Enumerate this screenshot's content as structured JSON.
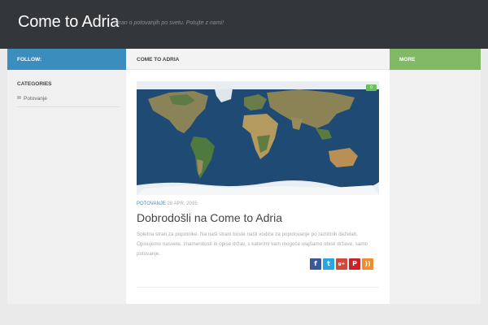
{
  "header": {
    "site_title": "Come to Adria",
    "site_description": "Stran o potovanjih po svetu. Potujte z nami!"
  },
  "sidebar_left": {
    "follow_label": "FOLLOW:",
    "categories_title": "CATEGORIES",
    "categories": [
      {
        "label": "Potovanje"
      }
    ]
  },
  "main": {
    "heading": "COME TO ADRIA",
    "post": {
      "image_icon": "world-map-image",
      "comment_count": "0",
      "comment_icon": "comment-icon",
      "category": "POTOVANJE",
      "date": "28 APR, 2015",
      "title": "Dobrodošli na Come to Adria",
      "excerpt": "Spletna stran za popotnike. Na naši strani boste našli vodiče za popotovanje po različnih deželah. Opisujemo nasvete, znamenitosti in opise držav, s katerimi vam mogoče olajšamo obisk države, samo potovanje."
    },
    "share": [
      {
        "name": "facebook",
        "glyph": "f",
        "icon": "facebook-icon",
        "color": "#3b5998"
      },
      {
        "name": "twitter",
        "glyph": "t",
        "icon": "twitter-icon",
        "color": "#2aa6df"
      },
      {
        "name": "google-plus",
        "glyph": "g+",
        "icon": "google-plus-icon",
        "color": "#d34836"
      },
      {
        "name": "pinterest",
        "glyph": "P",
        "icon": "pinterest-icon",
        "color": "#cb2027"
      },
      {
        "name": "rss",
        "glyph": "))",
        "icon": "rss-icon",
        "color": "#f08c2a"
      }
    ]
  },
  "sidebar_right": {
    "more_label": "MORE"
  },
  "colors": {
    "header_bg": "#33363b",
    "follow_bar": "#3b8dbd",
    "more_bar": "#82b965",
    "accent": "#3b8dbd"
  }
}
